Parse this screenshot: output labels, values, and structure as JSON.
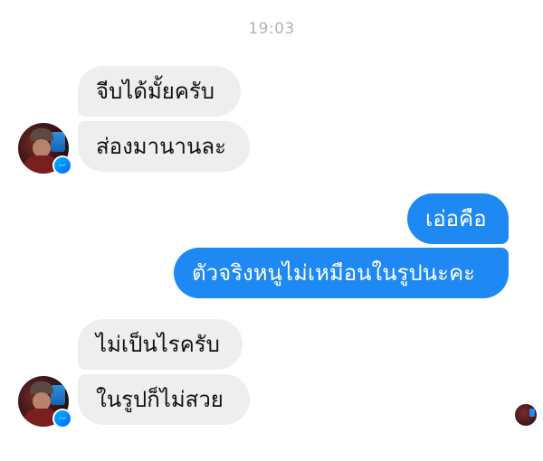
{
  "chat": {
    "timestamp": "19:03",
    "messages": [
      {
        "sender": "other",
        "text": "จีบได้มั้ยครับ"
      },
      {
        "sender": "other",
        "text": "ส่องมานานละ"
      },
      {
        "sender": "me",
        "text": "เอ่อคือ"
      },
      {
        "sender": "me",
        "text": "ตัวจริงหนูไม่เหมือนในรูปนะคะ"
      },
      {
        "sender": "other",
        "text": "ไม่เป็นไรครับ"
      },
      {
        "sender": "other",
        "text": "ในรูปก็ไม่สวย"
      }
    ]
  },
  "colors": {
    "incoming_bubble": "#eeeeee",
    "outgoing_bubble": "#1e88f3",
    "timestamp_text": "#b3b3b3",
    "messenger_badge": "#006aff"
  },
  "icons": {
    "avatar": "profile-avatar",
    "badge": "messenger-icon",
    "read_receipt": "seen-avatar"
  }
}
